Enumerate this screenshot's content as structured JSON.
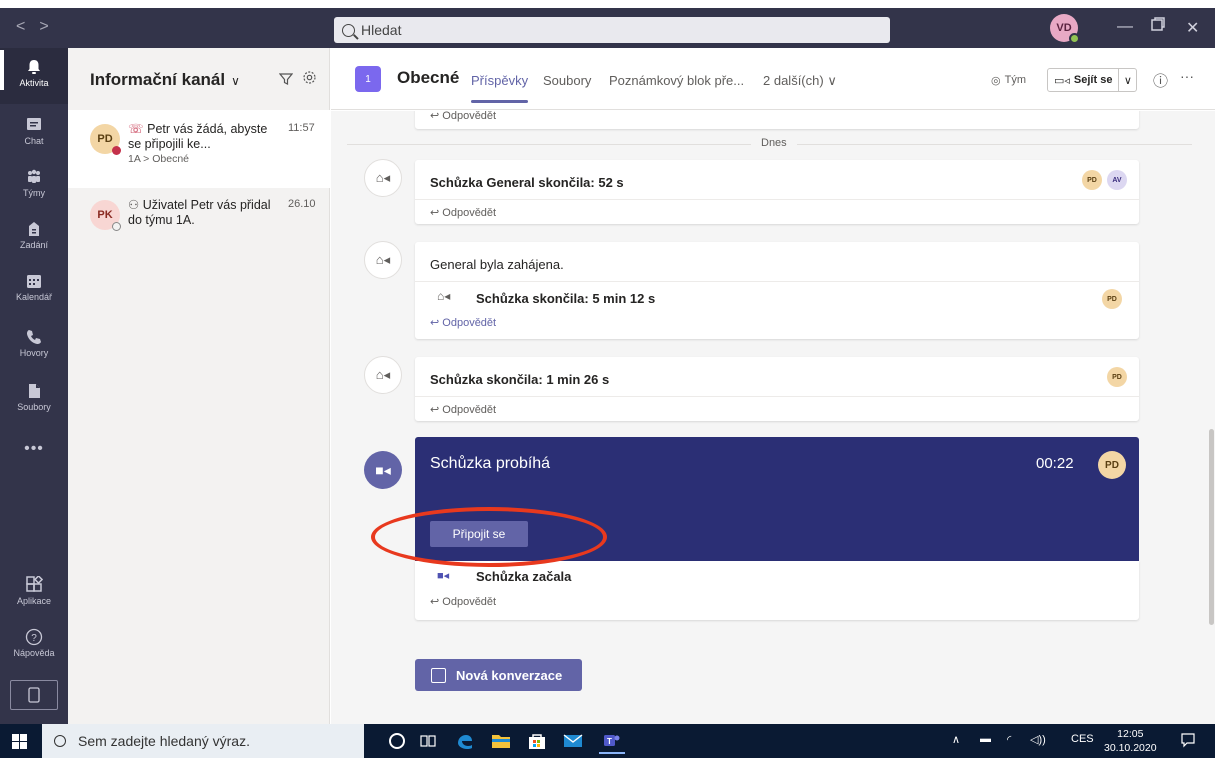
{
  "titlebar": {
    "search_placeholder": "Hledat",
    "user_initials": "VD",
    "nav_back": "<",
    "nav_forward": ">"
  },
  "rail": [
    {
      "label": "Aktivita",
      "icon": "bell-icon"
    },
    {
      "label": "Chat",
      "icon": "chat-icon"
    },
    {
      "label": "Týmy",
      "icon": "teams-icon"
    },
    {
      "label": "Zadání",
      "icon": "assignments-icon"
    },
    {
      "label": "Kalendář",
      "icon": "calendar-icon"
    },
    {
      "label": "Hovory",
      "icon": "phone-icon"
    },
    {
      "label": "Soubory",
      "icon": "file-icon"
    },
    {
      "label": "Aplikace",
      "icon": "apps-icon"
    },
    {
      "label": "Nápověda",
      "icon": "help-icon"
    }
  ],
  "rail_more": "•••",
  "activity": {
    "heading": "Informační kanál",
    "items": [
      {
        "initials": "PD",
        "text": "Petr vás žádá, abyste se připojili ke...",
        "sub": "1A > Obecné",
        "time": "11:57"
      },
      {
        "initials": "PK",
        "text": "Uživatel Petr vás přidal do týmu 1A.",
        "sub": "",
        "time": "26.10"
      }
    ]
  },
  "channel": {
    "team_number": "1",
    "name": "Obecné",
    "tabs": [
      "Příspěvky",
      "Soubory",
      "Poznámkový blok pře...",
      "2 další(ch)"
    ],
    "team_button": "Tým",
    "meet_button": "Sejít se"
  },
  "feed": {
    "reply_label": "Odpovědět",
    "day_label": "Dnes",
    "meeting1_title": "Schůzka General skončila: 52 s",
    "meeting1_avatars": [
      "PD",
      "AV"
    ],
    "meeting2_title": "General byla zahájena.",
    "meeting2_sub": "Schůzka skončila: 5 min 12 s",
    "meeting2_avatar": "PD",
    "meeting3_title": "Schůzka skončila: 1 min 26 s",
    "meeting3_avatar": "PD",
    "live_title": "Schůzka probíhá",
    "live_time": "00:22",
    "live_avatar": "PD",
    "join_button": "Připojit se",
    "live_started": "Schůzka začala",
    "new_conversation": "Nová konverzace"
  },
  "taskbar": {
    "search_placeholder": "Sem zadejte hledaný výraz.",
    "language": "CES",
    "time": "12:05",
    "date": "30.10.2020"
  },
  "colors": {
    "accent": "#6264a7",
    "rail": "#33344a",
    "live_card": "#2b2f75",
    "highlight": "#e8391e"
  }
}
